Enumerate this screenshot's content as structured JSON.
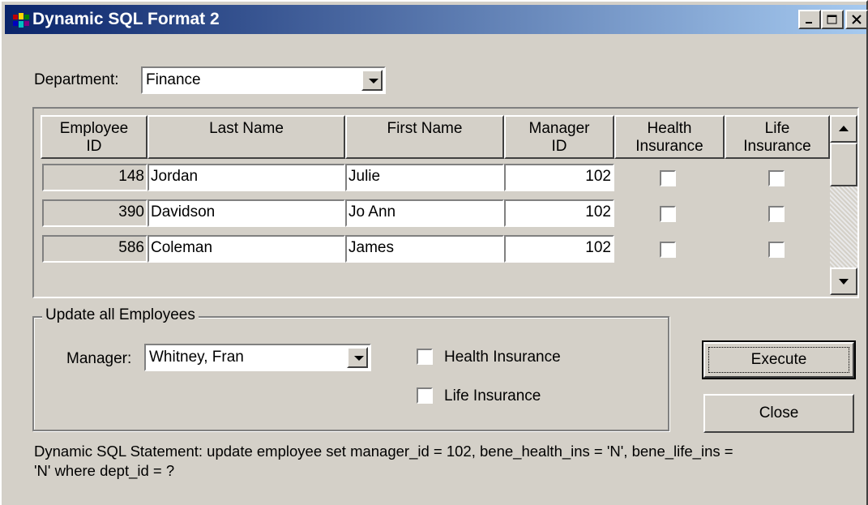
{
  "window": {
    "title": "Dynamic SQL Format 2",
    "controls": {
      "minimize": "_",
      "maximize": "□",
      "close": "x"
    }
  },
  "department": {
    "label": "Department:",
    "value": "Finance"
  },
  "grid": {
    "columns": [
      {
        "line1": "Employee",
        "line2": "ID"
      },
      {
        "line1": "Last Name",
        "line2": ""
      },
      {
        "line1": "First Name",
        "line2": ""
      },
      {
        "line1": "Manager",
        "line2": "ID"
      },
      {
        "line1": "Health",
        "line2": "Insurance"
      },
      {
        "line1": "Life",
        "line2": "Insurance"
      }
    ],
    "rows": [
      {
        "employee_id": "148",
        "last_name": "Jordan",
        "first_name": "Julie",
        "manager_id": "102",
        "health": false,
        "life": false
      },
      {
        "employee_id": "390",
        "last_name": "Davidson",
        "first_name": "Jo Ann",
        "manager_id": "102",
        "health": false,
        "life": false
      },
      {
        "employee_id": "586",
        "last_name": "Coleman",
        "first_name": "James",
        "manager_id": "102",
        "health": false,
        "life": false
      }
    ]
  },
  "update_group": {
    "title": "Update all Employees",
    "manager_label": "Manager:",
    "manager_value": "Whitney, Fran",
    "health_label": "Health Insurance",
    "health_checked": false,
    "life_label": "Life Insurance",
    "life_checked": false
  },
  "buttons": {
    "execute": "Execute",
    "close": "Close"
  },
  "statement": {
    "line1": "Dynamic SQL Statement:  update employee set manager_id = 102, bene_health_ins = 'N', bene_life_ins =",
    "line2": "'N' where dept_id = ?"
  }
}
